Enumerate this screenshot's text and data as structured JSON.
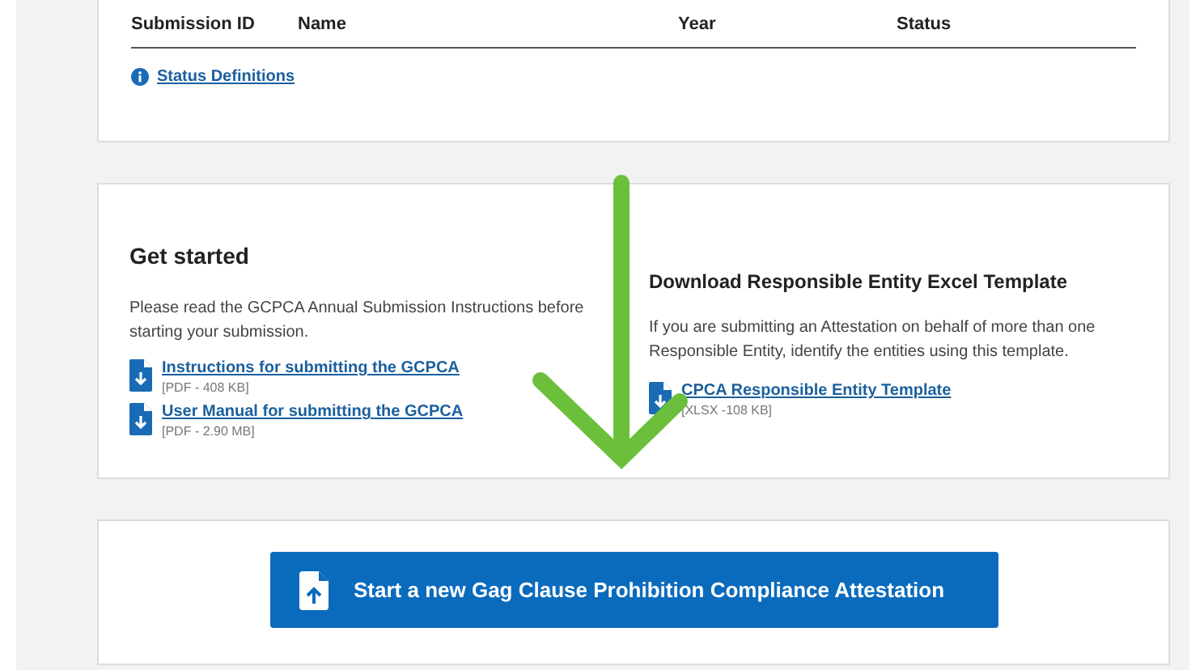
{
  "submissions_table": {
    "columns": [
      "Submission ID",
      "Name",
      "Year",
      "Status"
    ]
  },
  "status_definitions_link": "Status Definitions",
  "get_started": {
    "title": "Get started",
    "text": "Please read the GCPCA Annual Submission Instructions before starting your submission.",
    "downloads": [
      {
        "label": "Instructions for submitting the GCPCA",
        "meta": "[PDF - 408 KB]"
      },
      {
        "label": "User Manual for submitting the GCPCA",
        "meta": "[PDF - 2.90 MB]"
      }
    ]
  },
  "template": {
    "title": "Download Responsible Entity Excel Template",
    "text": "If you are submitting an Attestation on behalf of more than one Responsible Entity, identify the entities using this template.",
    "downloads": [
      {
        "label": "CPCA Responsible Entity Template",
        "meta": "[XLSX -108 KB]"
      }
    ]
  },
  "start_button": "Start a new Gag Clause Prohibition Compliance Attestation"
}
